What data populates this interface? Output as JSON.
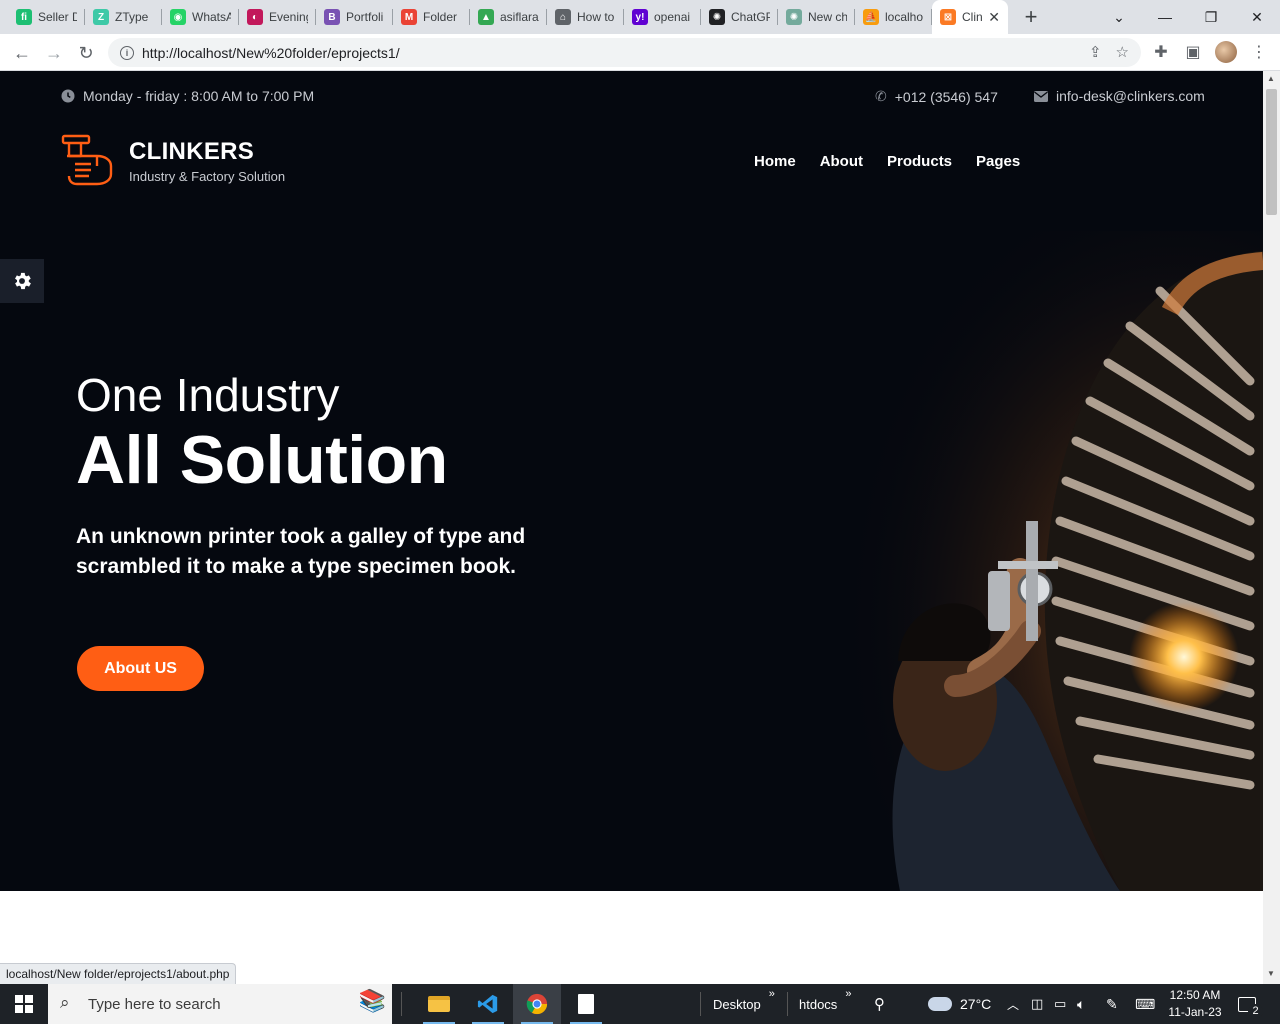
{
  "browser": {
    "tabs": [
      {
        "label": "Seller D",
        "icon": "fiverr-icon",
        "color": "#1dbf73",
        "glyph": "fi"
      },
      {
        "label": "ZType",
        "icon": "ztype-icon",
        "color": "#3ec9a7",
        "glyph": "Z"
      },
      {
        "label": "WhatsA",
        "icon": "whatsapp-icon",
        "color": "#25d366",
        "glyph": "◉"
      },
      {
        "label": "Evening",
        "icon": "evening-icon",
        "color": "#c2185b",
        "glyph": "◐"
      },
      {
        "label": "Portfoli",
        "icon": "bootstrap-icon",
        "color": "#7952b3",
        "glyph": "B"
      },
      {
        "label": "Folder",
        "icon": "gmail-icon",
        "color": "#ea4335",
        "glyph": "M"
      },
      {
        "label": "asiflara",
        "icon": "drive-icon",
        "color": "#34a853",
        "glyph": "▲"
      },
      {
        "label": "How to",
        "icon": "home-icon",
        "color": "#5f6368",
        "glyph": "⌂"
      },
      {
        "label": "openai",
        "icon": "yahoo-icon",
        "color": "#6001d2",
        "glyph": "y!"
      },
      {
        "label": "ChatGP",
        "icon": "chatgpt-icon",
        "color": "#202124",
        "glyph": "✺"
      },
      {
        "label": "New ch",
        "icon": "chatgpt-icon",
        "color": "#74aa9c",
        "glyph": "✺"
      },
      {
        "label": "localho",
        "icon": "phpmyadmin-icon",
        "color": "#f89c0e",
        "glyph": "⛵"
      }
    ],
    "active_tab": {
      "label": "Clin",
      "icon": "xampp-icon",
      "color": "#fb7a24",
      "glyph": "⊠"
    },
    "url": "http://localhost/New%20folder/eprojects1/",
    "status_url": "localhost/New folder/eprojects1/about.php"
  },
  "site": {
    "hours": "Monday - friday : 8:00 AM to 7:00 PM",
    "phone": "+012 (3546) 547",
    "email": "info-desk@clinkers.com",
    "brand": "CLINKERS",
    "tagline": "Industry & Factory Solution",
    "nav": [
      "Home",
      "About",
      "Products",
      "Pages"
    ],
    "hero_sub": "One Industry",
    "hero_title": "All Solution",
    "hero_desc": "An unknown printer took a galley of type and scrambled it to make a type specimen book.",
    "cta": "About US",
    "accent": "#ff5e14"
  },
  "taskbar": {
    "search_placeholder": "Type here to search",
    "desktop_label": "Desktop",
    "htdocs_label": "htdocs",
    "temperature": "27°C",
    "time": "12:50 AM",
    "date": "11-Jan-23",
    "notifications": "2"
  }
}
